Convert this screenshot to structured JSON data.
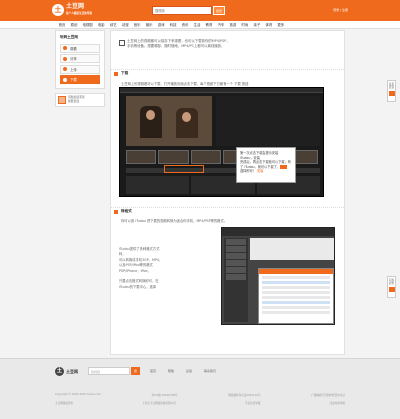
{
  "header": {
    "logo_mark": "土",
    "logo_title": "土豆网",
    "logo_sub": "每个人都是生活的导演",
    "search_placeholder": "搜视频",
    "search_button": "搜索",
    "right_text": "登录 | 注册"
  },
  "nav": [
    "首页",
    "原创",
    "电视剧",
    "电影",
    "综艺",
    "动漫",
    "音乐",
    "娱乐",
    "游戏",
    "科技",
    "资讯",
    "生活",
    "教育",
    "汽车",
    "旅游",
    "时尚",
    "亲子",
    "体育",
    "更多"
  ],
  "sidebar": {
    "title": "玩转土豆网",
    "items": [
      "观看",
      "分享",
      "上传",
      "下载"
    ],
    "active_index": 3,
    "feedback": [
      "问题反馈有奖",
      "我要反馈"
    ]
  },
  "main": {
    "intro": "土豆网上的视频都可以保存下来观看，也可以下载到你的MP4/PSP，\n手机等设备。想要哪部，随时随地，MP4/PC上都可以离线播放。",
    "section1_title": "下载",
    "section1_desc": "土豆网上的视频都可以下载，打开播放页面点击下载，每个视频下方都有一个 下载 按钮",
    "popup": [
      "第一次点击下载会提示安装 iTudou，安装",
      "完成后，再点击下载就可以下载，有",
      "了 iTudou，就可以下载了，",
      "选择即可！"
    ],
    "popup_link": "安装",
    "section2_title": "转格式",
    "section2_desc": "你可以用 iTudou 把下载的视频转换为适合你手机，MP4/PSP等的格式。",
    "side_list": [
      "iTudou提供了多种格式方式",
      "转，",
      "可以转换成手机3GP，MP4，",
      "以及PSP/iPod等的格式",
      "PSP/iPhone，iPod，",
      "",
      "只要点击格式转换即可，在",
      "iTudou的下载中心，选择"
    ]
  },
  "footer": {
    "logo": "土豆网",
    "search_placeholder": "搜视频",
    "search_button": "搜",
    "links": [
      "首页",
      "帮助",
      "反馈",
      "联系我们"
    ],
    "line1": [
      "Copyright © 2005-2010 Tudou.com",
      "沪ICP备 05016789号",
      "网络视听许可证0907116号",
      "广播电视节目制作经营许可证"
    ],
    "line2": [
      "土豆网版权所有",
      "上海全土豆网络科技有限公司",
      "不良信息举报",
      "违法内容举报"
    ]
  },
  "float_tabs": [
    "意见反馈",
    "问卷调查"
  ],
  "colors": {
    "brand": "#ef6a1c",
    "page_bg": "#f3f3f3"
  }
}
